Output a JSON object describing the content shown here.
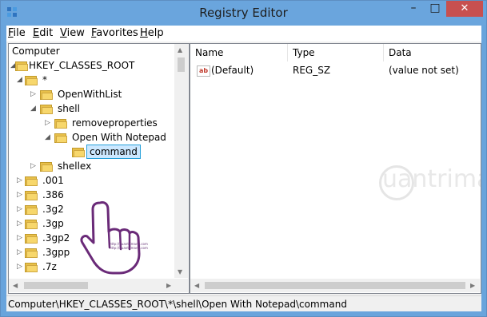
{
  "window": {
    "title": "Registry Editor"
  },
  "titlebar_buttons": {
    "minimize": "–",
    "maximize": "□",
    "close": "✕"
  },
  "menu": [
    {
      "accel": "F",
      "rest": "ile"
    },
    {
      "accel": "E",
      "rest": "dit"
    },
    {
      "accel": "V",
      "rest": "iew"
    },
    {
      "accel": "F",
      "rest": "avorites",
      "pre": ""
    },
    {
      "accel": "H",
      "rest": "elp"
    }
  ],
  "tree": {
    "root": "Computer",
    "hkcr": "HKEY_CLASSES_ROOT",
    "star": "*",
    "openwithlist": "OpenWithList",
    "shell": "shell",
    "removeproperties": "removeproperties",
    "open_with_notepad": "Open With Notepad",
    "command": "command",
    "shellex": "shellex",
    "ext1": ".001",
    "ext2": ".386",
    "ext3": ".3g2",
    "ext4": ".3gp",
    "ext5": ".3gp2",
    "ext6": ".3gpp",
    "ext7": ".7z"
  },
  "values": {
    "columns": {
      "name": "Name",
      "type": "Type",
      "data": "Data"
    },
    "rows": [
      {
        "icon": "ab",
        "name": "(Default)",
        "type": "REG_SZ",
        "data": "(value not set)"
      }
    ]
  },
  "status": {
    "path": "Computer\\HKEY_CLASSES_ROOT\\*\\shell\\Open With Notepad\\command"
  },
  "watermark": {
    "text": "uantrimang"
  },
  "hand_overlay": {
    "line1": "http://quantrimang.com",
    "line2": "http://quantrimang.com"
  },
  "colors": {
    "titlebar": "#6aa5dd",
    "close_button": "#c75050",
    "selection": "#cce8ff",
    "folder": "#f7d76c"
  },
  "icons": {
    "app": "registry-editor-icon",
    "folder": "folder-icon",
    "expand": "triangle-right-icon",
    "collapse": "triangle-down-icon",
    "string_value": "ab-string-icon",
    "pointer": "pointing-hand-icon"
  }
}
